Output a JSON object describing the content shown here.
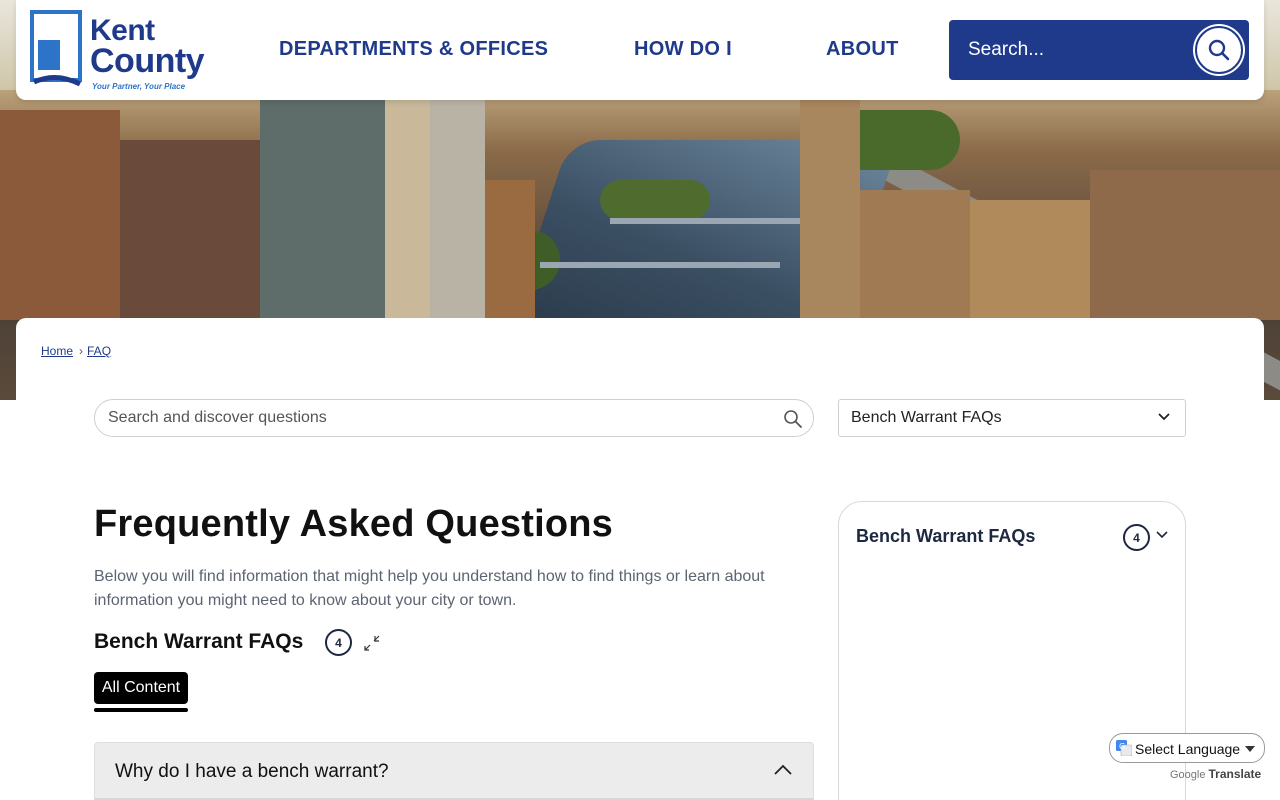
{
  "header": {
    "logo": {
      "line1": "Kent",
      "line2": "County",
      "tagline": "Your Partner, Your Place",
      "k_letter": "K"
    },
    "nav": [
      {
        "label": "DEPARTMENTS & OFFICES"
      },
      {
        "label": "HOW DO I"
      },
      {
        "label": "ABOUT"
      }
    ],
    "search": {
      "placeholder": "Search..."
    }
  },
  "breadcrumb": {
    "home": "Home",
    "separator": "›",
    "current": "FAQ"
  },
  "faq_search": {
    "placeholder": "Search and discover questions"
  },
  "category_select": {
    "value": "Bench Warrant FAQs"
  },
  "content": {
    "title": "Frequently Asked Questions",
    "intro": "Below you will find information that might help you understand how to find things or learn about information you might need to know about your city or town.",
    "section_title": "Bench Warrant FAQs",
    "section_count": "4",
    "tab_all": "All Content",
    "question1": "Why do I have a bench warrant?"
  },
  "side_panel": {
    "title": "Bench Warrant FAQs",
    "count": "4"
  },
  "translate": {
    "label": "Select Language",
    "powered_by": "Google",
    "translate_word": "Translate"
  },
  "colors": {
    "brand_blue": "#1f3a8a",
    "link_blue": "#2d73c8"
  },
  "icons": {
    "search": "search-icon",
    "chevron_down": "chevron-down-icon",
    "chevron_up": "chevron-up-icon",
    "collapse": "collapse-icon",
    "google_translate": "google-translate-icon"
  }
}
